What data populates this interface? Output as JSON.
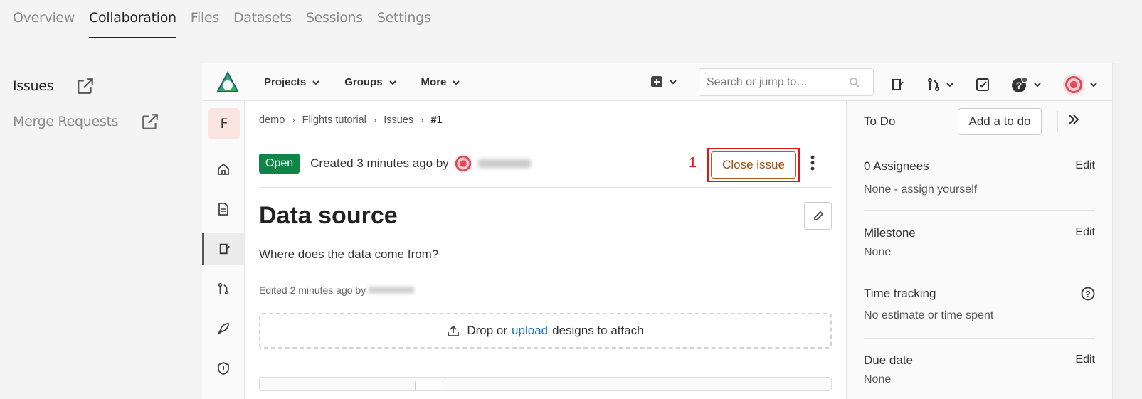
{
  "top_tabs": [
    "Overview",
    "Collaboration",
    "Files",
    "Datasets",
    "Sessions",
    "Settings"
  ],
  "outer_side": {
    "issues": "Issues",
    "merge_requests": "Merge Requests"
  },
  "gitlab": {
    "nav": {
      "projects": "Projects",
      "groups": "Groups",
      "more": "More"
    },
    "search_placeholder": "Search or jump to…",
    "rail_avatar_letter": "F",
    "breadcrumbs": {
      "c1": "demo",
      "c2": "Flights tutorial",
      "c3": "Issues",
      "c4": "#1"
    },
    "issue": {
      "status": "Open",
      "created_text": "Created 3 minutes ago by",
      "annotation_number": "1",
      "close_label": "Close issue",
      "title": "Data source",
      "description": "Where does the data come from?",
      "edited_text": "Edited 2 minutes ago by",
      "drop_prefix": "Drop or",
      "drop_link": "upload",
      "drop_suffix": "designs to attach"
    },
    "sidebar": {
      "todo_label": "To Do",
      "todo_button": "Add a to do",
      "assignees_label": "0 Assignees",
      "assignees_value": "None - assign yourself",
      "milestone_label": "Milestone",
      "milestone_value": "None",
      "time_label": "Time tracking",
      "time_value": "No estimate or time spent",
      "due_label": "Due date",
      "due_value": "None",
      "edit": "Edit"
    }
  },
  "colors": {
    "open_badge": "#108548",
    "annotation_red": "#e01515",
    "link_blue": "#1f75cb",
    "close_orange": "#9e4d10"
  }
}
